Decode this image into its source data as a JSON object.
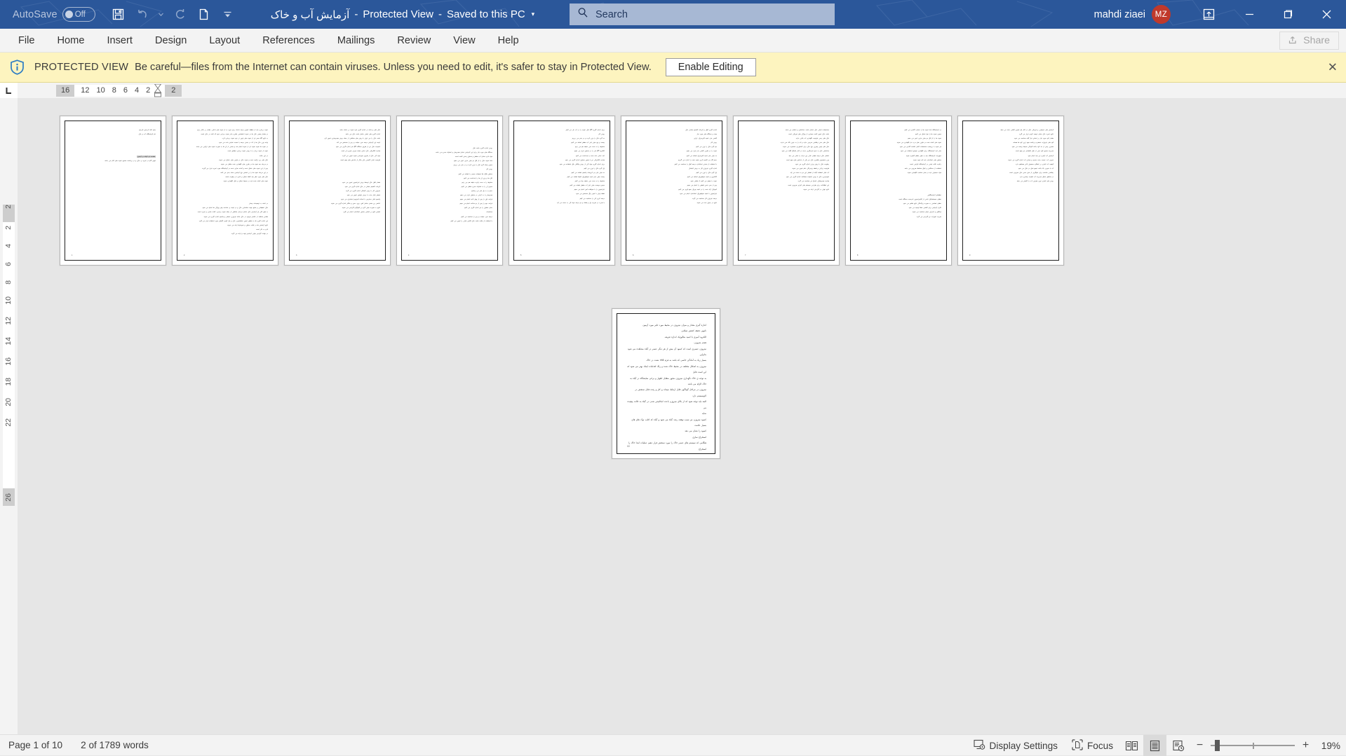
{
  "titlebar": {
    "autosave_label": "AutoSave",
    "autosave_state": "Off",
    "quick_access": [
      "save-icon",
      "undo-icon",
      "undo-dropdown-icon",
      "redo-icon",
      "new-doc-icon",
      "customize-qat-icon"
    ],
    "document_name": "آزمایش آب و خاک",
    "separator1": "-",
    "protected_view_state": "Protected View",
    "separator2": "-",
    "save_location": "Saved to this PC",
    "title_dropdown": "▾",
    "search_placeholder": "Search",
    "search_value": "",
    "user_name": "mahdi ziaei",
    "user_initials": "MZ",
    "ribbon_display_icon": "ribbon-display-options-icon",
    "minimize": "—",
    "restore": "❐",
    "close": "✕",
    "accent_color": "#2b579a",
    "avatar_color": "#c0392b"
  },
  "ribbon": {
    "tabs": [
      {
        "label": "File"
      },
      {
        "label": "Home"
      },
      {
        "label": "Insert"
      },
      {
        "label": "Design"
      },
      {
        "label": "Layout"
      },
      {
        "label": "References"
      },
      {
        "label": "Mailings"
      },
      {
        "label": "Review"
      },
      {
        "label": "View"
      },
      {
        "label": "Help"
      }
    ],
    "share_label": "Share"
  },
  "protected_view": {
    "icon": "shield-info-icon",
    "title": "PROTECTED VIEW",
    "message": "Be careful—files from the Internet can contain viruses. Unless you need to edit, it's safer to stay in Protected View.",
    "button_label": "Enable Editing",
    "close_label": "✕",
    "background_color": "#fdf4bf"
  },
  "rulers": {
    "corner_icon": "tab-stop-left-icon",
    "horizontal_marks": [
      "16",
      "12",
      "10",
      "8",
      "6",
      "4",
      "2",
      "2"
    ],
    "vertical_marks": [
      "2",
      "2",
      "4",
      "6",
      "8",
      "10",
      "12",
      "14",
      "16",
      "18",
      "20",
      "22",
      "26"
    ]
  },
  "statusbar": {
    "page_status": "Page 1 of 10",
    "word_count": "2 of 1789 words",
    "display_settings": "Display Settings",
    "display_settings_icon": "display-settings-icon",
    "focus": "Focus",
    "focus_icon": "focus-icon",
    "view_read_icon": "read-mode-icon",
    "view_print_icon": "print-layout-icon",
    "view_web_icon": "web-layout-icon",
    "zoom_out": "−",
    "zoom_in": "+",
    "zoom_level": "19%"
  },
  "document": {
    "page_count": 10,
    "rows": [
      {
        "pages": [
          {
            "number": "1",
            "blocks": [
              {
                "type": "center_right",
                "lines": [
                  "بسم الله الرحمن الرحیم",
                  "نام آزمایشگاه آب و خاک"
                ]
              },
              {
                "type": "gap"
              },
              {
                "type": "highlight",
                "lines": [
                  "مقدمه ای کوتاه بر آزمون"
                ]
              },
              {
                "type": "body",
                "lines": [
                  "اولین گام در تجزیه ی خاک و در برداشت صحیح نمونه های آغاز می باشد."
                ]
              }
            ]
          },
          {
            "number": "2",
            "blocks": [
              {
                "type": "body",
                "lines": [
                  "نمونه برداری باید از منطقه تصویر زمینه داشته برای مورد به از نمونه های داخلی، مقدار بر بالاتر برای",
                  "در مقدار بعضی خاک ها در نمونه اختصاصی نظری بنابر نمونه برداری شود که البته در خاک است",
                  "به نتایج آگاه صبر ای از نمونه های پایین تر خود نمونه برداری کرد.",
                  "واحد وزن خاک ها را که در بخش درصد یا نسبت نمایش داده می شود",
                  "در نمونه ها نمونه نمونه ای از نمونه انجام شد و بخشی از آن ها به صورت نمونه های ترکیبی می باشد",
                  "نمونه از نمونه بردار را با روش نمونه برداری مطابق است",
                  "در این حالت",
                  "خاک های ریز ترکیب شده و نمونه خاک در ظرف های خشک می شوند",
                  "در مرحله بعد نمونه ها در ظرف های نگهداری شده منتقل می شوند",
                  "پس از این نمونه های خشک شده و آماده سازی شده در آزمایشگاه مورد تجزیه قرار می گیرند",
                  "در این مرحله نمونه ها را بر اساس نوع آزمایش دسته بندی می کنند",
                  "خاک های مورد نظر باید کاملا خشک و عاری از رطوبت باشند",
                  "نمونه های آماده شده باید در محیط خشک و خنک نگهداری شوند"
                ]
              },
              {
                "type": "gap"
              },
              {
                "type": "body",
                "lines": [
                  "در ادامه به توضیحات بیشتر",
                  "خاک تحقیقاتی و منابع جهت شناسایی خاک و در نتیجه ی شناخت بهتر ویژگی ها انجام می شود",
                  "به طور کلی هر آزمایش خاک شامل مراحل مختلفی از جمله نمونه برداری، آماده سازی و تجزیه است",
                  "مقادیر مختلف از عناصر موجود در خاک مانند نیتروژن، فسفر و پتاسیم اندازه گیری می شوند",
                  "این اندازه گیری ها به منظور تعیین حاصلخیزی خاک و نیاز کودی گیاهان مورد استفاده قرار می گیرد",
                  "نتایج آزمایش ها در قالب جداول و نمودارها ارائه می شوند",
                  "لازم به ذکر است",
                  "در نهایت گزارش نهایی آزمایش تهیه و ارائه می گردد"
                ]
              }
            ]
          },
          {
            "number": "3",
            "blocks": [
              {
                "type": "body",
                "lines": [
                  "خاک های و مانند در اندازه گیری قوه نمونه بر داشته باشد",
                  "اندازه گیری های اصلی شامل بافت خاک می باشد",
                  "بافت خاک را می توان با روش های مختلفی از جمله روش هیدرومتری تعیین کرد",
                  "نتیجه این آزمایش درصد شن، سیلت و رس را مشخص می کند",
                  "اسیدیته خاک نیز از طریق دستگاه pH متر اندازه گیری می شود",
                  "هدایت الکتریکی خاک نشان دهنده میزان شوری آن است",
                  "مواد آلی خاک از طریق سوزاندن نمونه تعیین می گردد",
                  "ظرفیت تبادل کاتیونی یکی دیگر از شاخص های مهم است"
                ]
              },
              {
                "type": "gap"
              },
              {
                "type": "body",
                "lines": [
                  "مقدار آهک خاک توسط روش تیتراسیون تعیین می شود",
                  "کربنات کلسیم معادل در خاک اندازه گیری می شود",
                  "نیتروژن کل با روش کجلدال اندازه گیری می گردد",
                  "فسفر قابل جذب با روش اولسن تعیین می شود",
                  "پتاسیم قابل دسترس با استات آمونیوم استخراج می شود",
                  "عناصر ریز مغذی شامل آهن، روی، مس و منگنز اندازه گیری می شوند",
                  "نتایج به صورت میلی گرم بر کیلوگرم گزارش می شوند",
                  "تفسیر نتایج بر اساس جداول استاندارد انجام می گیرد"
                ]
              }
            ]
          },
          {
            "number": "4",
            "blocks": [
              {
                "type": "gap"
              },
              {
                "type": "body",
                "lines": [
                  "روش اندازه گیری بافت خاک",
                  "دستگاه های مورد نیاز برای این آزمایش شامل هیدرومتر و استوانه مدرج می باشد",
                  "مواد لازم شامل آب مقطر و محلول پخش کننده است",
                  "ابتدا نمونه خاک را از الک دو میلی متری عبور می دهیم",
                  "سپس پنجاه گرم خاک را وزن کرده و در بشر می ریزیم",
                  "روش کار",
                  "محلول هگزا متا فسفات سدیم را اضافه می کنیم",
                  "الک ها و وزن آن ها را یادداشت می کنیم",
                  "مخلوط را به مدت پانزده دقیقه هم می زنیم",
                  "سپس آن را به استوانه مدرج منتقل می کنیم",
                  "حجم را به یک لیتر می رسانیم",
                  "هیدرومتر را به آرامی در محلول قرار می دهیم",
                  "قرائت اول را پس از چهل ثانیه انجام می دهیم",
                  "قرائت دوم را پس از دو ساعت انجام می دهیم",
                  "دمای محلول را نیز اندازه گیری می کنیم",
                  "محاسبات",
                  "درصد شن، سیلت و رس را محاسبه می کنیم",
                  "با استفاده از مثلث بافت خاک کلاس بافتی را تعیین می کنیم"
                ]
              }
            ]
          },
          {
            "number": "5",
            "blocks": [
              {
                "type": "body",
                "lines": [
                  "برای اندازه گیری pH خاک نمونه را در آب حل می کنیم",
                  "روش کار",
                  "ده گرم خاک را وزن کرده و در بشر می ریزیم",
                  "بیست و پنج میلی لیتر آب مقطر اضافه می کنیم",
                  "مخلوط را به مدت سی دقیقه هم می زنیم",
                  "الکترود pH متر را در محلول قرار می دهیم",
                  "عدد نشان داده شده را یادداشت می کنیم",
                  "هدایت الکتریکی نیز با همین محلول اندازه گیری می شود",
                  "برای اندازه گیری مواد آلی از روش والکلی بلک استفاده می شود",
                  "یک گرم خاک را وزن می کنیم",
                  "ده میلی لیتر دی کرومات پتاسیم اضافه می کنیم",
                  "بیست میلی لیتر اسید سولفوریک غلیظ اضافه می کنیم",
                  "مخلوط را به مدت سی دقیقه رها می کنیم",
                  "سپس دویست میلی لیتر آب مقطر اضافه می کنیم",
                  "تیتراسیون را با سولفات آهن انجام می دهیم",
                  "نقطه پایان با تغییر رنگ مشخص می شود",
                  "درصد کربن آلی را محاسبه می کنیم",
                  "با ضرب در ضریب یک و هفتاد و دو درصد مواد آلی به دست می آید"
                ]
              }
            ]
          },
          {
            "number": "6",
            "blocks": [
              {
                "type": "body",
                "lines": [
                  "اندازه گیری آهک و کربنات کلسیم معادل خاک",
                  "مواد و دستگاه های مورد نیاز",
                  "کلسی متر، اسید کلریدریک، ترازو",
                  "روش کار",
                  "نیم گرم خاک را وزن می کنیم",
                  "نمونه را در ظرف کلسی متر قرار می دهیم",
                  "ده میلی لیتر اسید کلریدریک اضافه می کنیم",
                  "حجم گاز دی اکسید کربن تولید شده را اندازه می گیریم",
                  "با استفاده از منحنی استاندارد درصد آهک را محاسبه می کنیم",
                  "اندازه گیری نیتروژن کل به روش کجلدال",
                  "یک گرم خاک را وزن می کنیم",
                  "کاتالیزور و اسید سولفوریک اضافه می کنیم",
                  "نمونه را هضم می کنیم تا شفاف شود",
                  "پس از سرد شدن تقطیر را انجام می دهیم",
                  "آمونیاک آزاد شده را در اسید بوریک جمع آوری می کنیم",
                  "تیتراسیون با اسید سولفوریک استاندارد انجام می شود",
                  "درصد نیتروژن کل محاسبه می گردد",
                  "نتایج در جدول ثبت می شوند"
                ]
              }
            ]
          },
          {
            "number": "7",
            "blocks": [
              {
                "type": "body",
                "lines": [
                  "مشخصات اصلی خاک شامل بافت، ساختمان و تخلخل می باشد",
                  "بافت خاک تعیین کننده بسیاری از ویژگی های فیزیکی است",
                  "خاک های رسی ظرفیت نگهداری آب بالایی دارند",
                  "خاک های شنی زهکشی سریعی دارند و آب را به خوبی نگه نمی دارند",
                  "خاک های لومی بهترین نوع خاک برای کشاورزی محسوب می شوند",
                  "ساختمان خاک به نحوه قرارگیری ذرات در کنار یکدیگر گفته می شود",
                  "تخلخل خاک درصد فضای خالی بین ذرات را نشان می دهد",
                  "وزن مخصوص ظاهری خاک نیز یکی از شاخص های مهم است",
                  "رطوبت خاک با روش وزنی اندازه گیری می شود",
                  "ظرفیت زراعی و نقطه پژمردگی دائم تعیین می شوند",
                  "آب قابل استفاده گیاه از تفاضل این دو به دست می آید",
                  "نفوذپذیری خاک با روش استوانه مضاعف اندازه گیری می شود",
                  "هدایت هیدرولیکی اشباع نیز محاسبه می گردد",
                  "این اطلاعات برای طراحی سیستم های آبیاری ضروری است",
                  "نتایج نهایی در گزارش ارائه می شوند"
                ]
              }
            ]
          },
          {
            "number": "8",
            "blocks": [
              {
                "type": "body",
                "lines": [
                  "در آزمایشگاه ابتدا نمونه ها را شماره گذاری می کنیم",
                  "سپس نمونه ها را هوا خشک می کنیم",
                  "نمونه ها را از الک دو میلی متری عبور می دهیم",
                  "نمونه های آماده شده در ظرف های درب دار نگهداری می شوند",
                  "هر نمونه با برچسب مشخصات کامل علامت گذاری می شود",
                  "دفتر ثبت آزمایشگاه برای نگهداری سوابق استفاده می شود",
                  "تجهیزات آزمایشگاه باید به طور منظم کالیبره شوند",
                  "محلول های استاندارد باید تازه تهیه شوند",
                  "رعایت نکات ایمنی در آزمایشگاه الزامی است",
                  "استفاده از دستکش و عینک محافظ ضروری می باشد",
                  "مواد شیمیایی باید در محل مناسب نگهداری شوند"
                ]
              },
              {
                "type": "gap"
              },
              {
                "type": "body",
                "lines": [
                  "خطاهای آزمایشگاهی",
                  "خطای سیستماتیک ناشی از کالیبراسیون نادرست دستگاه است",
                  "خطای تصادفی به صورت پراکندگی نتایج ظاهر می شود",
                  "تکرار آزمایش برای کاهش خطا توصیه می شود",
                  "میانگین و انحراف معیار محاسبه می شوند",
                  "ضریب تغییرات نیز گزارش می گردد"
                ]
              }
            ]
          },
          {
            "number": "9",
            "blocks": [
              {
                "type": "body",
                "lines": [
                  "آزمایش های شیمیایی و فیزیکی خاک در کنار هم تصویر کاملی ارائه می دهند",
                  "نتایج تجزیه خاک مبنای توصیه کودی قرار می گیرد",
                  "مقدار کود مورد نیاز بر اساس نیاز گیاه محاسبه می شود",
                  "کود های نیتروژنه، فسفره و پتاسه مهم ترین کود ها هستند",
                  "مصرف بیش از حد کود باعث آلودگی محیط زیست می شود",
                  "مدیریت صحیح کود دهی از نظر اقتصادی نیز مهم است",
                  "آزمایش آب آبیاری نیز باید انجام شود",
                  "شوری آب، نسبت جذب سدیم و سختی آب اندازه گیری می شوند",
                  "کیفیت آب آبیاری بر عملکرد محصول تاثیر مستقیم دارد",
                  "آب با شوری بالا باعث تجمع نمک در خاک می شود",
                  "زهکشی مناسب برای جلوگیری از شور شدن خاک ضروری است",
                  "در مناطق خشک مدیریت آب اهمیت بیشتری دارد",
                  "روش های آبیاری نوین مصرف آب را کاهش می دهند"
                ]
              }
            ]
          }
        ]
      },
      {
        "pages": [
          {
            "number": "10",
            "blocks": [
              {
                "type": "body",
                "lines": [
                  "اندازه گیری مقدار و میزان نیتروژن در محیط مورد تاثیر مورد آزمون",
                  "نامهی دقیقه کشش سیلابی",
                  "الکترود آمپری با اسید متالوژیک اندازه تعریف",
                  "هضم نیتروژن",
                  "نیتروژن عنصری است که کمبود آن بیش از هر دیگر عنصر در گیاه مشاهده می شود بنابراین",
                  "بسیار زیاد به آمادگی خاصی که باشد به فرم nh4 نشت در خاک",
                  "نیتروژن به اشکال مختلف در محیط خاک شده و زنگ اقدامات ایجاد بهتر می شود که این است قابل",
                  "به توجه ی خاک نگهداری نیتروژن مجهز متقابل اظهار و برخی نمایشگاه در گیاه به خاک الزام می باشد",
                  "نیتروژن در مراحل گوناگون قابل ارتباط میماند و کلر و رفت قابل سنجش در اکوسیستم دارد",
                  "البته باید توجه شود که از بالای نیتروژن باعث امکانپذیر شدن در گیاه به حالت پیچیده می",
                  "نماید",
                  "کمبود نیتروژن نیز سبب توقف رشد گیاه می شود و گیاه که اغلب نوک های های بسیار علامت",
                  "کمبود را نشان می دهد",
                  "استخراج سازی",
                  "هنگامی که سیستم های عنصر خاک را مورد سنجش قرار دهیم عملیات ابتدا خاک را استخراج",
                  "کرده نگهداشته شده و نمونه مخزن دارد و آب را مورد نیاز به روی از آن را آزمایشگاهی مربوطه صورت",
                  "گیرد",
                  "برای استخراج سازی خاک را ابتدا درون نظر را در درون لوله های قرار داده از آن است مقدار",
                  "میزان خاک را با مقدار که هم میزان اضافه خواهد کرد در آن را یادداشت علمی داده میباشد غالب",
                  "دوزان های خاک کارخانه درون خاک نمایند زمان مخاطب مورد آن را که خاصیت خاک در",
                  "آن است و را فرایند محصور آنها می شود هدف مخاطب و آزمایشات مربوطه را در درون آن آنجام",
                  "میدهد"
                ]
              }
            ]
          }
        ]
      }
    ]
  }
}
